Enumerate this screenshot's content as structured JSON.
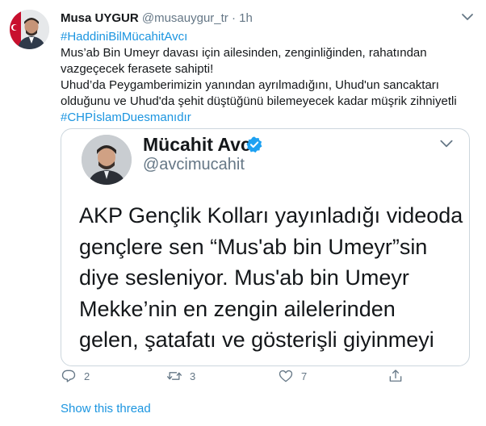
{
  "tweet": {
    "author_name": "Musa UYGUR",
    "author_handle": "@musauygur_tr",
    "separator": "·",
    "time": "1h",
    "hashtag_top": "#HaddiniBilMücahitAvcı",
    "line1": "Mus’ab Bin Umeyr davası için ailesinden, zenginliğinden, rahatından",
    "line2": "vazgeçecek ferasete sahipti!",
    "line3": "Uhud’da Peygamberimizin yanından ayrılmadığını, Uhud'un sancaktarı",
    "line4": "olduğunu ve Uhud'da şehit düştüğünü bilemeyecek kadar müşrik zihniyetli",
    "hashtag_bottom": "#CHPİslamDuesmanıdır"
  },
  "quoted": {
    "name": "Mücahit Avcı",
    "handle": "@avcimucahit",
    "lines": [
      "AKP Gençlik Kolları yayınladığı videoda",
      "gençlere sen “Mus'ab bin Umeyr”sin",
      "diye sesleniyor. Mus'ab bin Umeyr",
      "Mekke’nin en zengin ailelerinden",
      "gelen, şatafatı ve gösterişli giyinmeyi"
    ]
  },
  "actions": {
    "reply_count": "2",
    "retweet_count": "3",
    "like_count": "7"
  },
  "show_thread": "Show this thread",
  "icons": {
    "caret": "chevron-down-icon",
    "verified": "verified-badge-icon",
    "reply": "reply-icon",
    "retweet": "retweet-icon",
    "like": "heart-icon",
    "share": "share-icon"
  },
  "colors": {
    "link": "#1b95e0",
    "secondary_text": "#657786",
    "border": "#ccd6dd"
  }
}
